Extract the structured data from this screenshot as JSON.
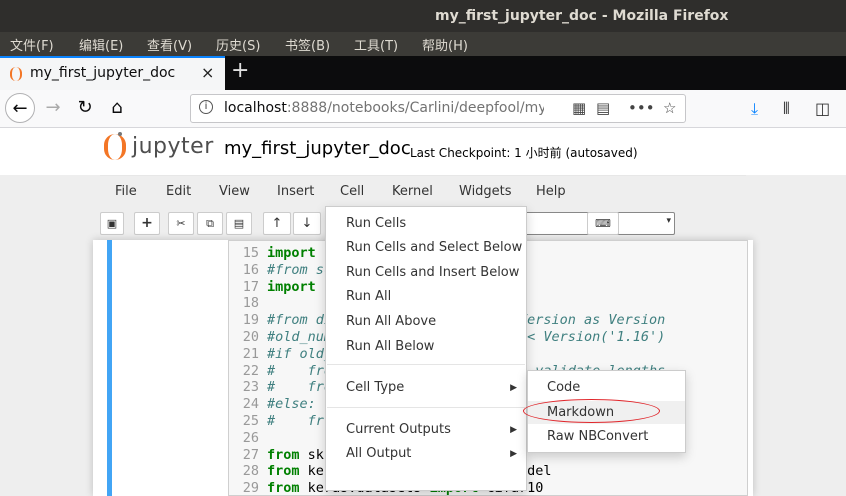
{
  "window": {
    "title": "my_first_jupyter_doc - Mozilla Firefox"
  },
  "browser_menu": [
    "文件(F)",
    "编辑(E)",
    "查看(V)",
    "历史(S)",
    "书签(B)",
    "工具(T)",
    "帮助(H)"
  ],
  "tab": {
    "title": "my_first_jupyter_doc",
    "close": "×",
    "new": "+"
  },
  "urlbar": {
    "host": "localhost",
    "rest": ":8888/notebooks/Carlini/deepfool/my"
  },
  "jupyter": {
    "logo": "jupyter",
    "notebook_name": "my_first_jupyter_doc",
    "checkpoint": "Last Checkpoint: 1 小时前   (autosaved)"
  },
  "nb_menu": [
    "File",
    "Edit",
    "View",
    "Insert",
    "Cell",
    "Kernel",
    "Widgets",
    "Help"
  ],
  "code_lines": [
    {
      "n": "15",
      "parts": [
        {
          "k": "kw",
          "t": "import"
        },
        {
          "k": "tx",
          "t": " n"
        }
      ]
    },
    {
      "n": "16",
      "parts": [
        {
          "k": "cm",
          "t": "#from sc"
        }
      ]
    },
    {
      "n": "17",
      "parts": [
        {
          "k": "kw",
          "t": "import"
        },
        {
          "k": "tx",
          "t": " c"
        }
      ]
    },
    {
      "n": "18",
      "parts": []
    },
    {
      "n": "19",
      "parts": [
        {
          "k": "cm",
          "t": "#from di                   poseVersion as Version"
        }
      ]
    },
    {
      "n": "20",
      "parts": [
        {
          "k": "cm",
          "t": "#old_num                   n__) < Version('1.16')"
        }
      ]
    },
    {
      "n": "21",
      "parts": [
        {
          "k": "cm",
          "t": "#if old_"
        }
      ]
    },
    {
      "n": "22",
      "parts": [
        {
          "k": "cm",
          "t": "#    fro                    ort  validate_lengths"
        }
      ]
    },
    {
      "n": "23",
      "parts": [
        {
          "k": "cm",
          "t": "#    fro"
        }
      ]
    },
    {
      "n": "24",
      "parts": [
        {
          "k": "cm",
          "t": "#else:"
        }
      ]
    },
    {
      "n": "25",
      "parts": [
        {
          "k": "cm",
          "t": "#    fr"
        }
      ]
    },
    {
      "n": "26",
      "parts": []
    },
    {
      "n": "27",
      "parts": [
        {
          "k": "kw",
          "t": "from"
        },
        {
          "k": "tx",
          "t": " ski"
        }
      ]
    },
    {
      "n": "28",
      "parts": [
        {
          "k": "kw",
          "t": "from"
        },
        {
          "k": "tx",
          "t": " keras.models "
        },
        {
          "k": "kw",
          "t": "import"
        },
        {
          "k": "tx",
          "t": " load_model"
        }
      ]
    },
    {
      "n": "29",
      "parts": [
        {
          "k": "kw",
          "t": "from"
        },
        {
          "k": "tx",
          "t": " keras.datasets "
        },
        {
          "k": "kw",
          "t": "import"
        },
        {
          "k": "tx",
          "t": " cifar10"
        }
      ]
    }
  ],
  "cell_menu": {
    "items": [
      "Run Cells",
      "Run Cells and Select Below",
      "Run Cells and Insert Below",
      "Run All",
      "Run All Above",
      "Run All Below",
      "Cell Type",
      "Current Outputs",
      "All Output"
    ]
  },
  "cell_type_submenu": [
    "Code",
    "Markdown",
    "Raw NBConvert"
  ],
  "colors": {
    "accent": "#0a84ff",
    "jupyter_orange": "#f37626",
    "cell_selected": "#42a5f5",
    "annotation": "#e0262b"
  }
}
